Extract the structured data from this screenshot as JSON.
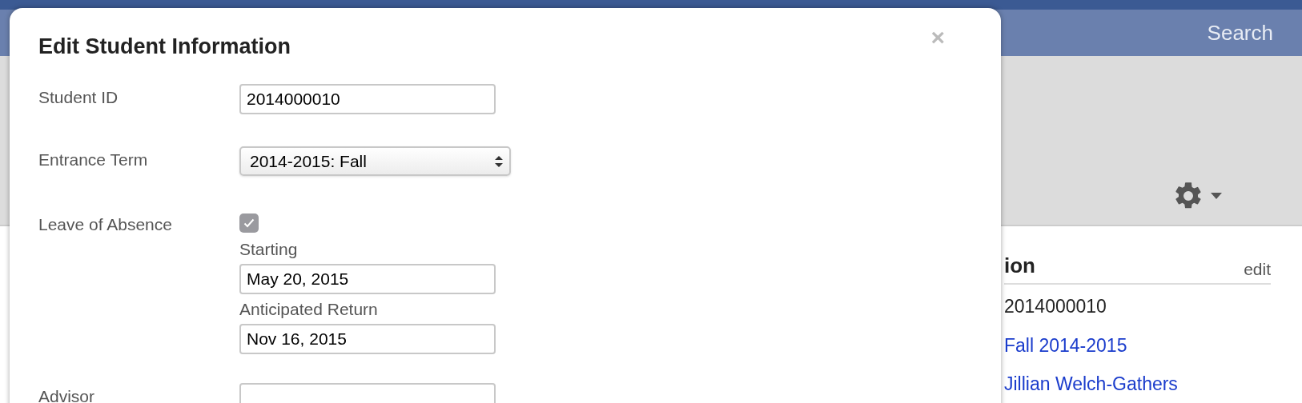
{
  "header": {
    "search_link": "Search"
  },
  "profile_section": {
    "heading": "ion",
    "edit_link": "edit",
    "rows": [
      {
        "kind": "text",
        "value": "2014000010"
      },
      {
        "kind": "link",
        "value": "Fall 2014-2015"
      },
      {
        "kind": "link",
        "value": "Jillian Welch-Gathers"
      }
    ]
  },
  "modal": {
    "title": "Edit Student Information",
    "close": "×",
    "fields": [
      {
        "kind": "text",
        "label": "Student ID",
        "value": "2014000010"
      },
      {
        "kind": "select",
        "label": "Entrance Term",
        "value": "2014-2015: Fall"
      },
      {
        "kind": "checkbox",
        "label": "Leave of Absence",
        "checked": true,
        "dates": [
          {
            "label": "Starting",
            "value": "May 20, 2015"
          },
          {
            "label": "Anticipated Return",
            "value": "Nov 16, 2015"
          }
        ]
      },
      {
        "kind": "text",
        "label": "Advisor"
      }
    ]
  }
}
